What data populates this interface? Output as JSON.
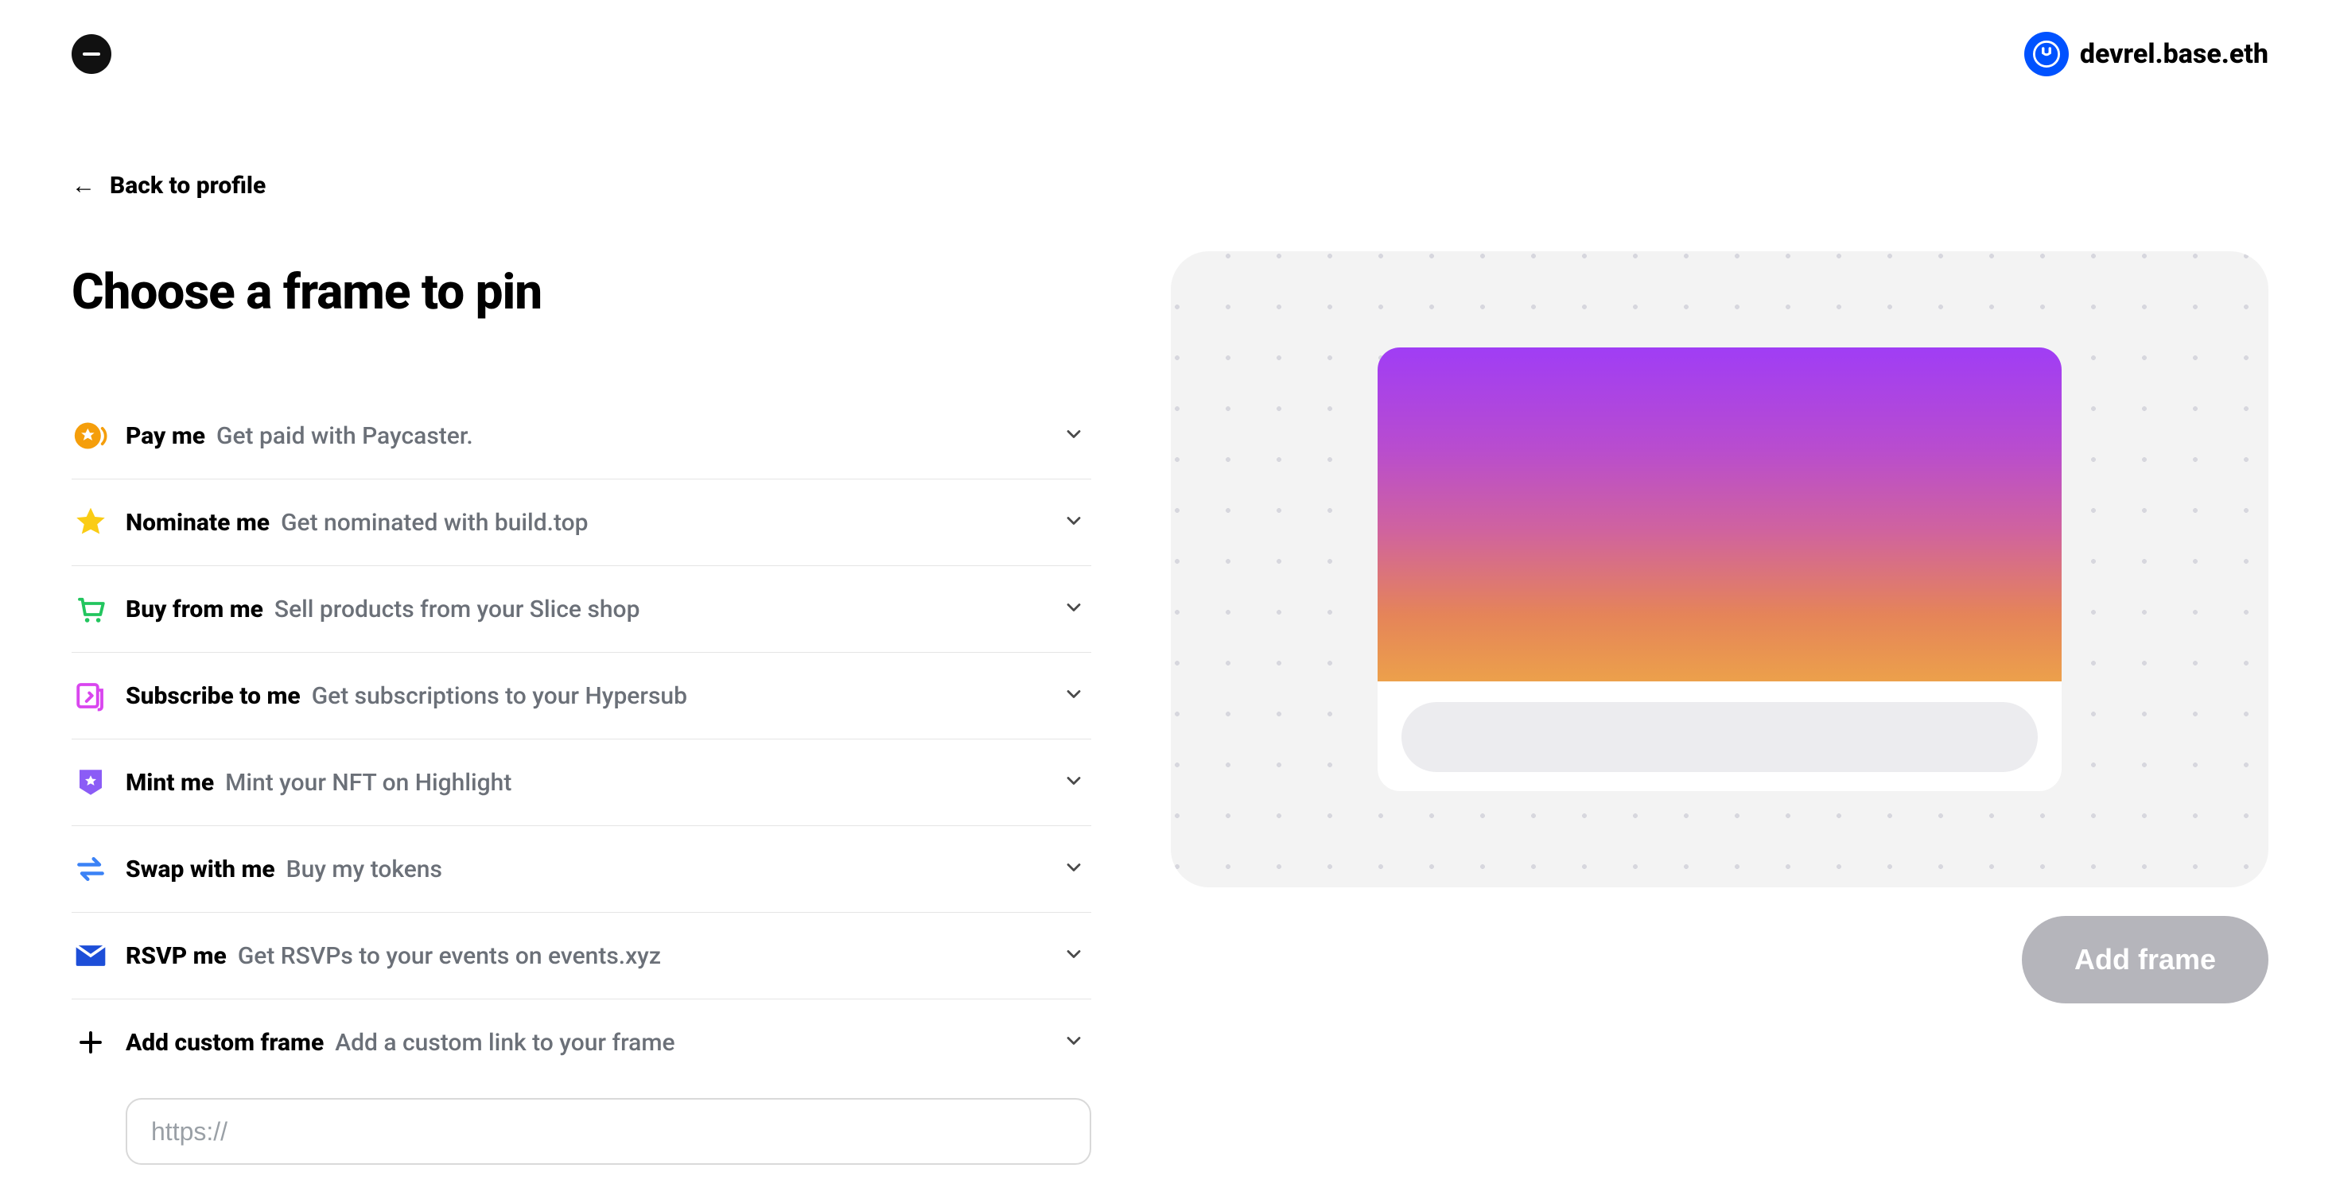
{
  "header": {
    "user_label": "devrel.base.eth"
  },
  "back_label": "Back to profile",
  "page_title": "Choose a frame to pin",
  "frames": [
    {
      "id": "pay",
      "title": "Pay me",
      "desc": "Get paid with Paycaster."
    },
    {
      "id": "nominate",
      "title": "Nominate me",
      "desc": "Get nominated with build.top"
    },
    {
      "id": "buy",
      "title": "Buy from me",
      "desc": "Sell products from your Slice shop"
    },
    {
      "id": "subscribe",
      "title": "Subscribe to me",
      "desc": "Get subscriptions to your Hypersub"
    },
    {
      "id": "mint",
      "title": "Mint me",
      "desc": "Mint your NFT on Highlight"
    },
    {
      "id": "swap",
      "title": "Swap with me",
      "desc": "Buy my tokens"
    },
    {
      "id": "rsvp",
      "title": "RSVP me",
      "desc": "Get RSVPs to your events on events.xyz"
    },
    {
      "id": "custom",
      "title": "Add custom frame",
      "desc": "Add a custom link to your frame"
    }
  ],
  "custom_url_placeholder": "https://",
  "add_frame_label": "Add frame"
}
